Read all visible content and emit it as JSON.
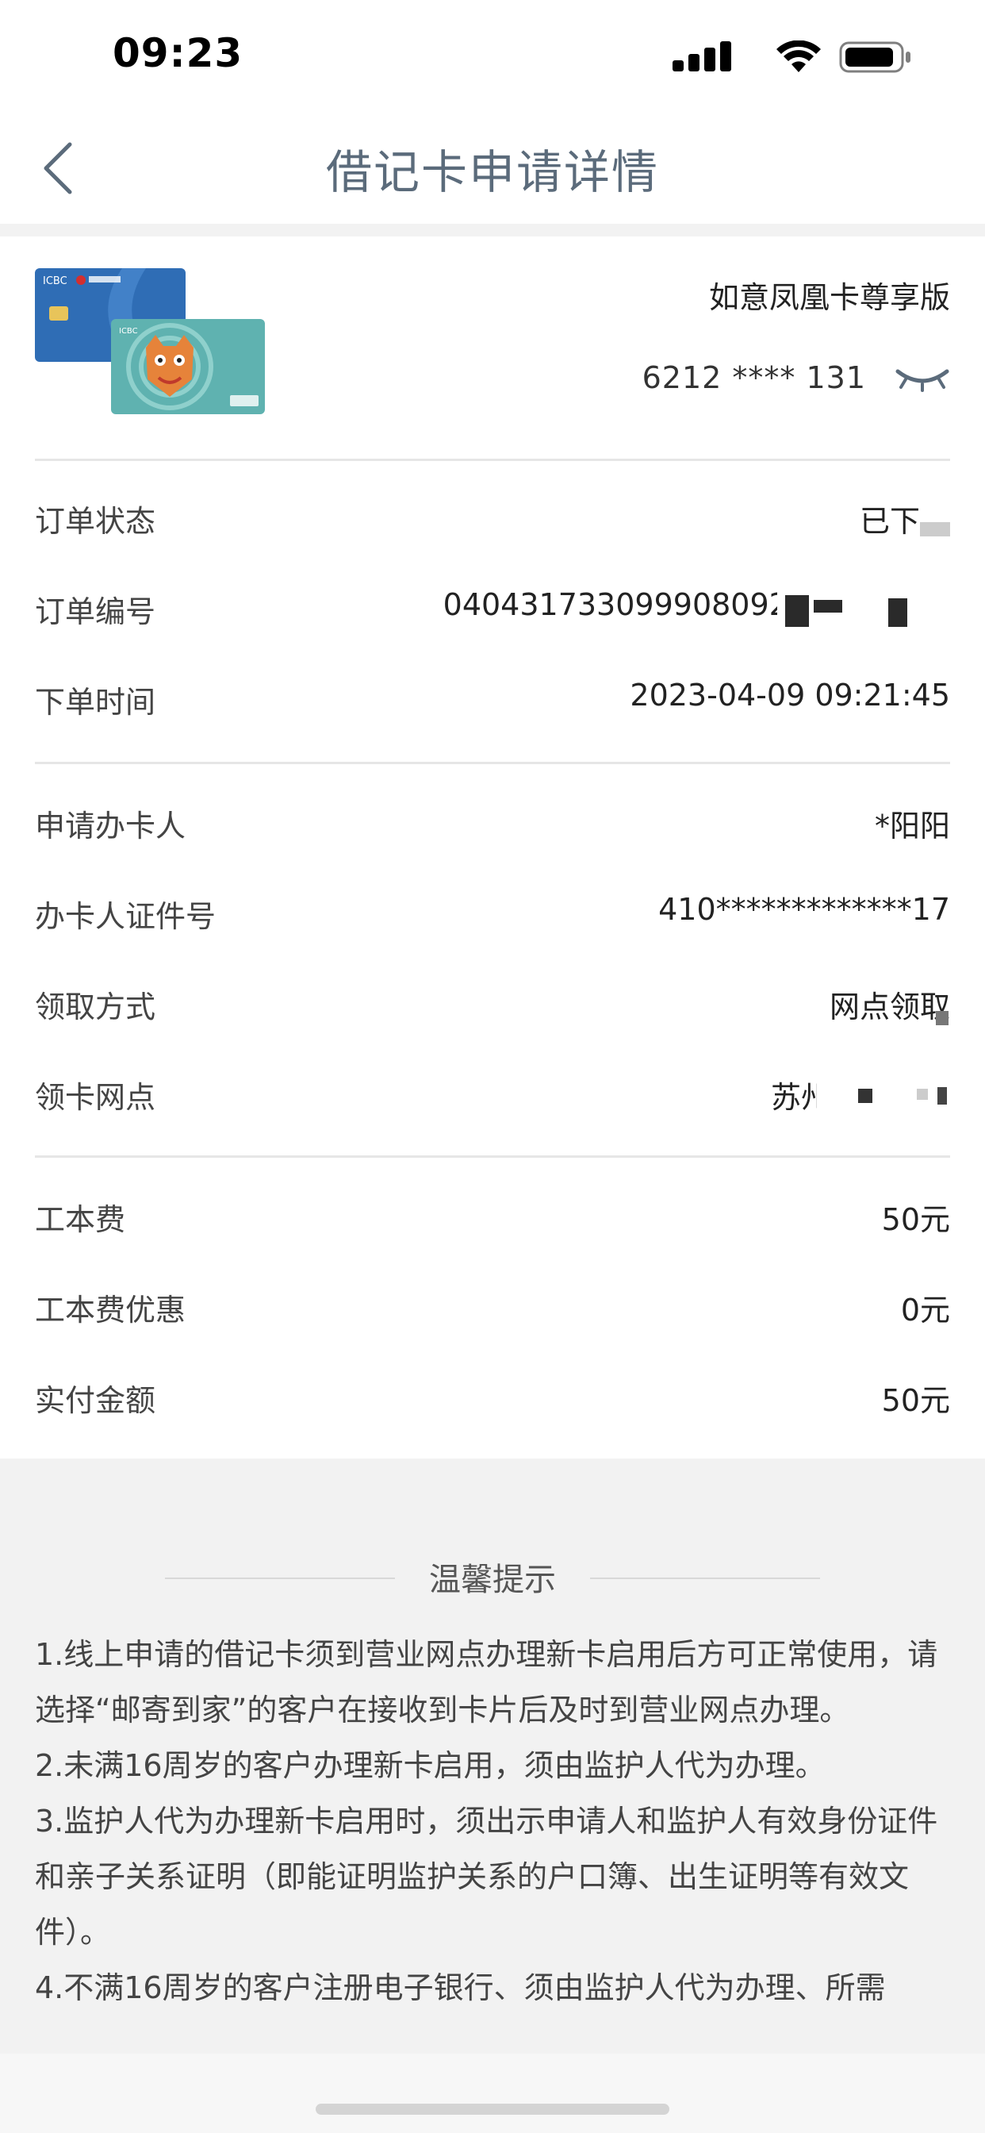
{
  "status_bar": {
    "time": "09:23"
  },
  "nav": {
    "title": "借记卡申请详情"
  },
  "card": {
    "name": "如意凤凰卡尊享版",
    "number_masked": "6212 **** 131",
    "colors": {
      "card_blue": "#2f6db5",
      "card_teal": "#5fb2b0"
    }
  },
  "order": {
    "status_label": "订单状态",
    "status_value": "已下单",
    "number_label": "订单编号",
    "number_value": "0404317330999080921",
    "time_label": "下单时间",
    "time_value": "2023-04-09 09:21:45"
  },
  "applicant": {
    "name_label": "申请办卡人",
    "name_value": "*阳阳",
    "id_label": "办卡人证件号",
    "id_value": "410*************17",
    "pickup_label": "领取方式",
    "pickup_value": "网点领取",
    "branch_label": "领卡网点",
    "branch_value": "苏州"
  },
  "fees": {
    "fee_label": "工本费",
    "fee_value": "50元",
    "discount_label": "工本费优惠",
    "discount_value": "0元",
    "paid_label": "实付金额",
    "paid_value": "50元"
  },
  "tips": {
    "title": "温馨提示",
    "item1": "1.线上申请的借记卡须到营业网点办理新卡启用后方可正常使用，请选择“邮寄到家”的客户在接收到卡片后及时到营业网点办理。",
    "item2": "2.未满16周岁的客户办理新卡启用，须由监护人代为办理。",
    "item3": "3.监护人代为办理新卡启用时，须出示申请人和监护人有效身份证件和亲子关系证明（即能证明监护关系的户口簿、出生证明等有效文件）。",
    "item4": "4.不满16周岁的客户注册电子银行、须由监护人代为办理、所需"
  }
}
